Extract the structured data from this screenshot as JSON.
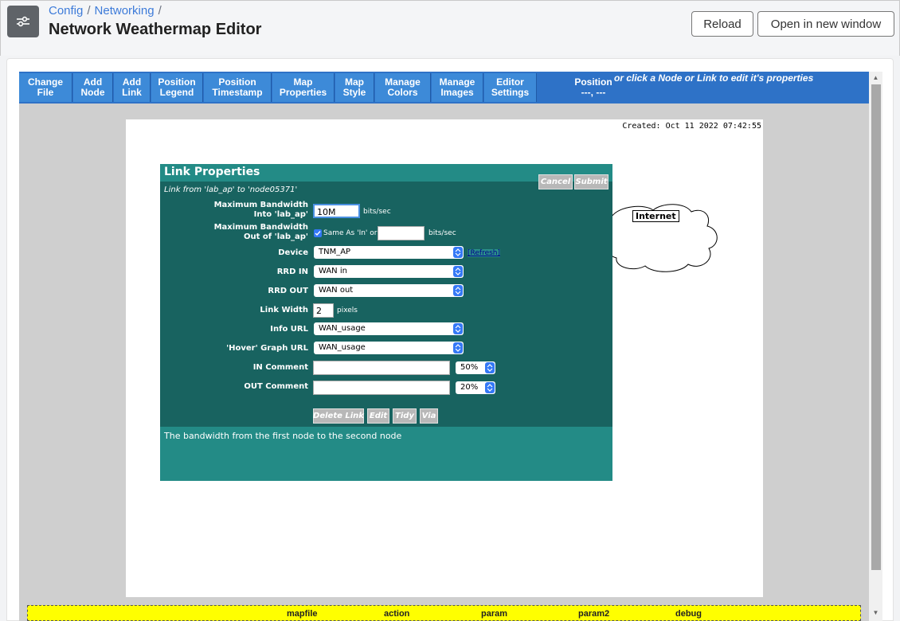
{
  "header": {
    "breadcrumb": [
      "Config",
      "Networking"
    ],
    "breadcrumb_separator": "/",
    "title": "Network Weathermap Editor",
    "reload_label": "Reload",
    "open_new_window_label": "Open in new window"
  },
  "toolbar": {
    "buttons": [
      "Change\nFile",
      "Add\nNode",
      "Add\nLink",
      "Position\nLegend",
      "Position\nTimestamp",
      "Map\nProperties",
      "Map\nStyle",
      "Manage\nColors",
      "Manage\nImages",
      "Editor\nSettings"
    ],
    "position_label": "Position",
    "position_value": "---, ---",
    "hint": "or click a Node or Link to edit it's properties"
  },
  "map": {
    "created": "Created: Oct 11 2022 07:42:55",
    "node_label": "Internet"
  },
  "dialog": {
    "title": "Link Properties",
    "subtitle": "Link from 'lab_ap' to 'node05371'",
    "cancel_label": "Cancel",
    "submit_label": "Submit",
    "fields": {
      "max_bw_in_label": "Maximum Bandwidth\nInto 'lab_ap'",
      "max_bw_in_value": "10M",
      "bits_per_sec": "bits/sec",
      "max_bw_out_label": "Maximum Bandwidth\nOut of 'lab_ap'",
      "same_as_in_label": "Same As 'In' or",
      "same_as_in_checked": true,
      "max_bw_out_value": "",
      "device_label": "Device",
      "device_value": "TNM_AP",
      "refresh_label": "[Refresh]",
      "rrd_in_label": "RRD IN",
      "rrd_in_value": "WAN in",
      "rrd_out_label": "RRD OUT",
      "rrd_out_value": "WAN out",
      "link_width_label": "Link Width",
      "link_width_value": "2",
      "pixels": "pixels",
      "info_url_label": "Info URL",
      "info_url_value": "WAN_usage",
      "hover_graph_label": "'Hover' Graph URL",
      "hover_graph_value": "WAN_usage",
      "in_comment_label": "IN Comment",
      "in_comment_value": "",
      "in_comment_pos": "50%",
      "out_comment_label": "OUT Comment",
      "out_comment_value": "",
      "out_comment_pos": "20%"
    },
    "actions": [
      "Delete Link",
      "Edit",
      "Tidy",
      "Via"
    ],
    "help_text": "The bandwidth from the first node to the second node"
  },
  "debug": {
    "columns": [
      "mapfile",
      "action",
      "param",
      "param2",
      "debug"
    ]
  },
  "colors": {
    "toolbar_bg": "#2e72c7",
    "dialog_bg": "#186360",
    "dialog_accent": "#238b86",
    "link_blue": "#3d7bd9",
    "debug_bg": "#ffff00"
  }
}
